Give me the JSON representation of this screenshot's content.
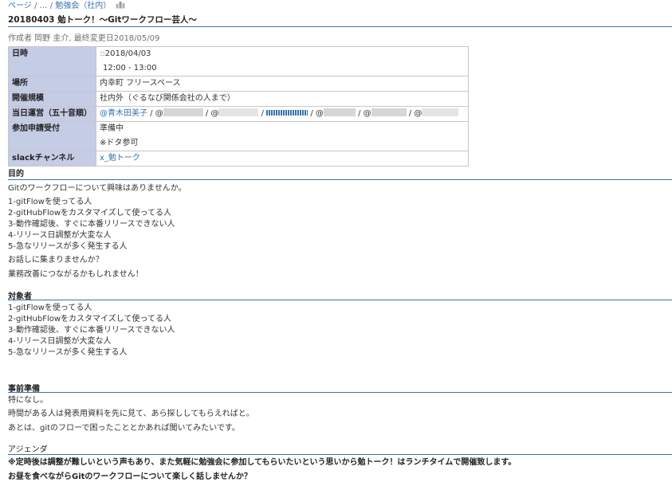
{
  "breadcrumb": {
    "root": "ページ",
    "ellipsis": "…",
    "parent": "勉強会（社内）"
  },
  "page_title": "20180403 勉トーク！～Gitワークフロー芸人～",
  "byline": "作成者 岡野 圭介, 最終変更日2018/05/09",
  "meta_table": {
    "date_label": "日時",
    "date_value": "2018/04/03",
    "time_value": "12:00 - 13:00",
    "place_label": "場所",
    "place_value": "内幸町 フリースペース",
    "scale_label": "開催規模",
    "scale_value": "社内外（ぐるなび関係会社の人まで）",
    "staff_label": "当日運営（五十音順）",
    "staff_first": "@青木田美子",
    "staff_sep": " / @",
    "entry_label": "参加申請受付",
    "entry_status": "準備中",
    "entry_note": "※ドタ参可",
    "slack_label": "slackチャンネル",
    "slack_value": "x_勉トーク"
  },
  "purpose": {
    "heading": "目的",
    "intro": "Gitのワークフローについて興味はありませんか。",
    "items": [
      "1-gitFlowを使ってる人",
      "2-gitHubFlowをカスタマイズして使ってる人",
      "3-動作確認後、すぐに本番リリースできない人",
      "4-リリース日調整が大変な人",
      "5-急なリリースが多く発生する人"
    ],
    "q1": "お話しに集まりませんか？",
    "q2": "業務改善につながるかもしれません！"
  },
  "audience": {
    "heading": "対象者",
    "items": [
      "1-gitFlowを使ってる人",
      "2-gitHubFlowをカスタマイズして使ってる人",
      "3-動作確認後、すぐに本番リリースできない人",
      "4-リリース日調整が大変な人",
      "5-急なリリースが多く発生する人"
    ]
  },
  "prep": {
    "heading": "事前準備",
    "lines": [
      "特になし。",
      "時間がある人は発表用資料を先に見て、あら探ししてもらえればと。",
      "あとは、gitのフローで困ったこととかあれば聞いてみたいです。"
    ]
  },
  "agenda": {
    "heading": "アジェンダ",
    "line1": "※定時後は調整が難しいという声もあり、また気軽に勉強会に参加してもらいたいという思いから勉トーク！はランチタイムで開催致します。",
    "line2": "お昼を食べながらGitのワークフローについて楽しく話しませんか？"
  }
}
